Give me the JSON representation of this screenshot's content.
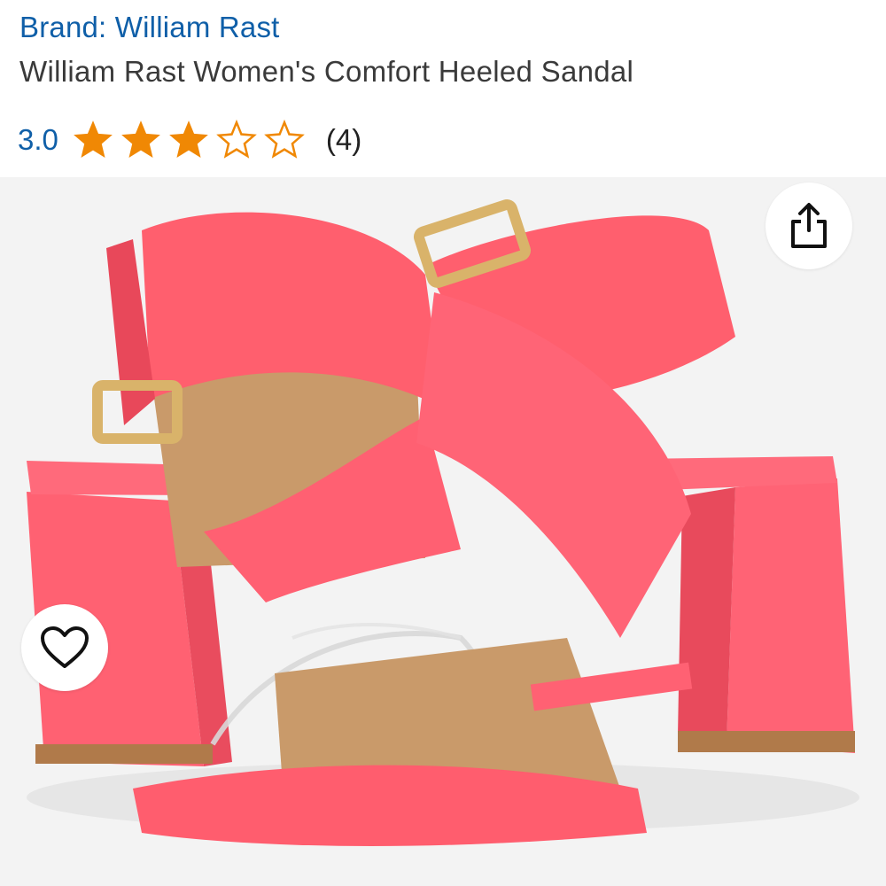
{
  "product": {
    "brand_label": "Brand: William Rast",
    "title": "William Rast Women's Comfort Heeled Sandal"
  },
  "rating": {
    "value_text": "3.0",
    "value": 3.0,
    "max": 5,
    "review_count_text": "(4)",
    "star_color": "#f08804"
  },
  "image": {
    "description_icon": "product-photo",
    "sandal_color": "#ff5f6e",
    "insole_color": "#c99a6a",
    "buckle_color": "#d9b36a"
  },
  "actions": {
    "share_icon": "share-icon",
    "wishlist_icon": "heart-icon"
  },
  "colors": {
    "link": "#0f5fa8",
    "title_text": "#3a3a3a",
    "background": "#ffffff",
    "image_background": "#f3f3f3"
  }
}
